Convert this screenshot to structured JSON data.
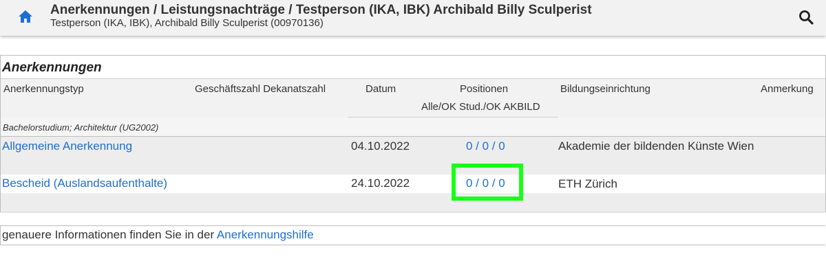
{
  "header": {
    "title": "Anerkennungen / Leistungsnachträge  / Testperson (IKA, IBK) Archibald Billy Sculperist",
    "subtitle": "Testperson (IKA, IBK), Archibald Billy Sculperist (00970136)",
    "home_icon": "home-icon",
    "search_icon": "search-icon"
  },
  "section": {
    "title": "Anerkennungen",
    "columns": {
      "type": "Anerkennungstyp",
      "gz": "Geschäftszahl Dekanatszahl",
      "date": "Datum",
      "positions": "Positionen",
      "positions_sub": "Alle/OK Stud./OK AKBILD",
      "institution": "Bildungseinrichtung",
      "remark": "Anmerkung"
    },
    "group": "Bachelorstudium; Architektur (UG2002)",
    "rows": [
      {
        "type": "Allgemeine Anerkennung",
        "date": "04.10.2022",
        "positions": "0 / 0 / 0",
        "institution": "Akademie der bildenden Künste Wien"
      },
      {
        "type": "Bescheid (Auslandsaufenthalte)",
        "date": "24.10.2022",
        "positions": "0 / 0 / 0",
        "institution": "ETH Zürich"
      }
    ]
  },
  "footer": {
    "text": "genauere Informationen finden Sie in der",
    "link": "Anerkennungshilfe"
  },
  "colors": {
    "link": "#1f6fd1",
    "highlight": "#19ff19"
  }
}
